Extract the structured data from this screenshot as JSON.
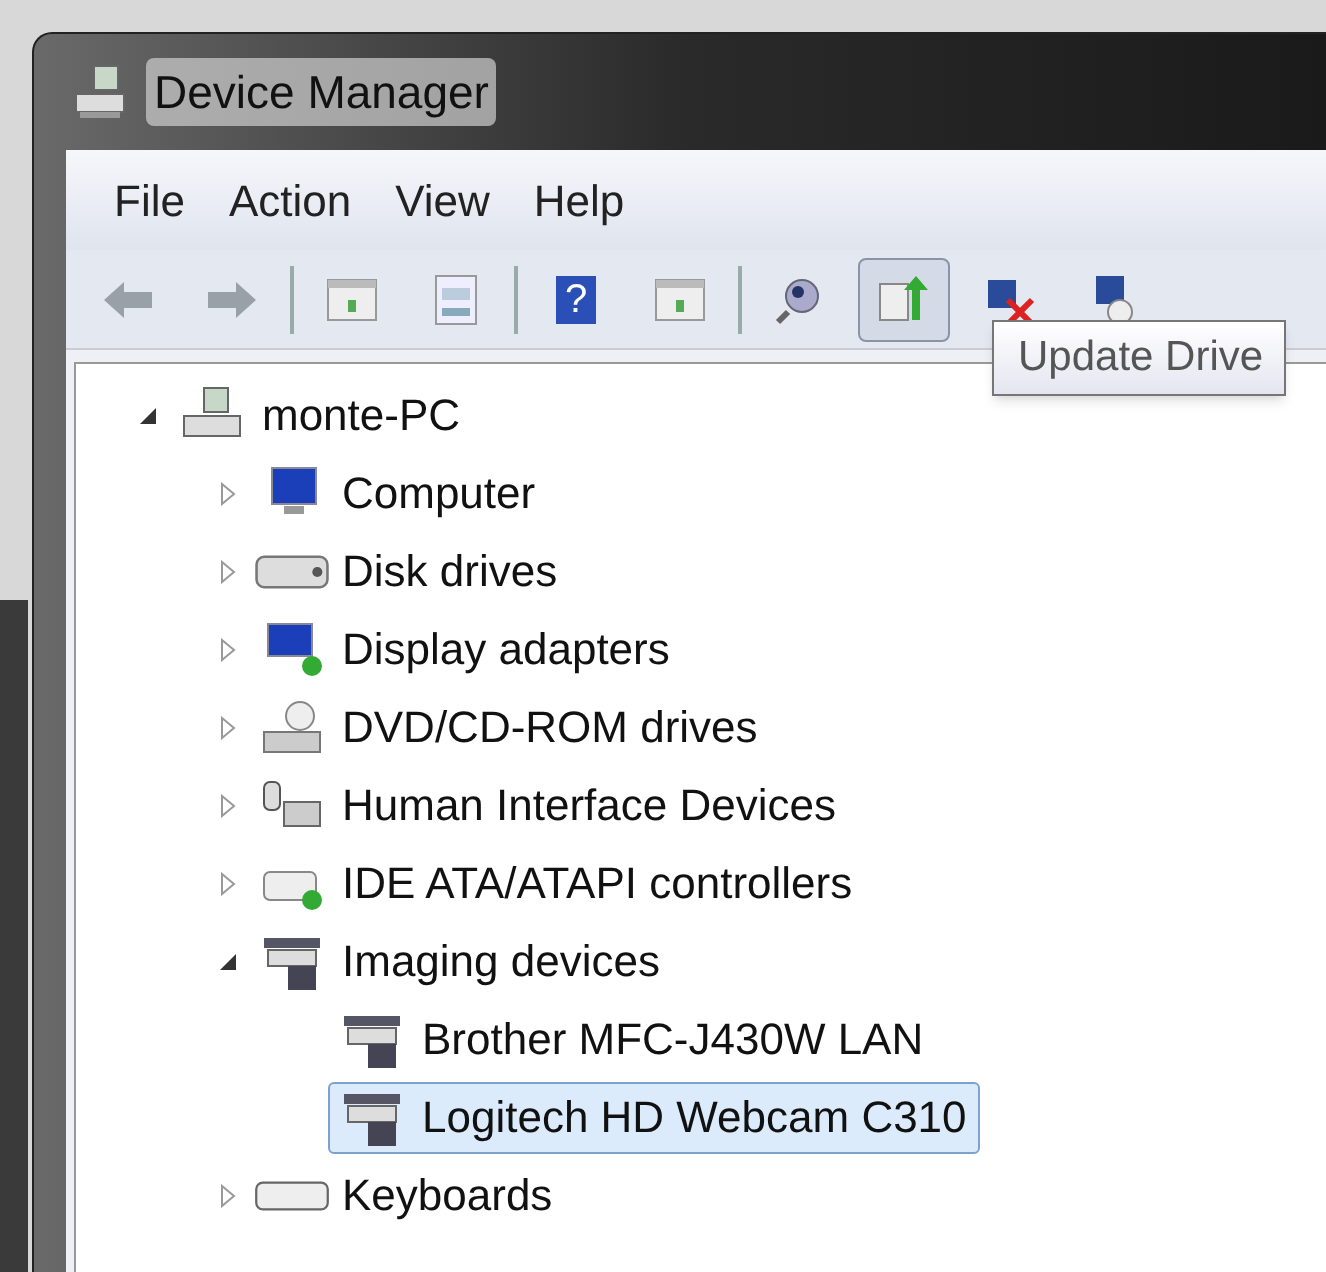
{
  "window": {
    "title": "Device Manager"
  },
  "menu": [
    "File",
    "Action",
    "View",
    "Help"
  ],
  "toolbar": [
    {
      "kind": "back",
      "pressed": false
    },
    {
      "kind": "forward",
      "pressed": false
    },
    {
      "kind": "separator"
    },
    {
      "kind": "properties",
      "pressed": false
    },
    {
      "kind": "document",
      "pressed": false
    },
    {
      "kind": "separator"
    },
    {
      "kind": "help",
      "label": "?",
      "pressed": false
    },
    {
      "kind": "properties",
      "pressed": false
    },
    {
      "kind": "separator"
    },
    {
      "kind": "scan",
      "pressed": false
    },
    {
      "kind": "update",
      "pressed": true
    },
    {
      "kind": "disable",
      "pressed": false
    },
    {
      "kind": "uninstall",
      "pressed": false
    }
  ],
  "tooltip": {
    "text": "Update Drive"
  },
  "tree": [
    {
      "label": "monte-PC",
      "kind": "computer",
      "expanded": true,
      "selected": false,
      "children": [
        {
          "label": "Computer",
          "kind": "monitor",
          "expanded": false,
          "selected": false
        },
        {
          "label": "Disk drives",
          "kind": "disk",
          "expanded": false,
          "selected": false
        },
        {
          "label": "Display adapters",
          "kind": "display",
          "expanded": false,
          "selected": false
        },
        {
          "label": "DVD/CD-ROM drives",
          "kind": "dvd",
          "expanded": false,
          "selected": false
        },
        {
          "label": "Human Interface Devices",
          "kind": "hid",
          "expanded": false,
          "selected": false
        },
        {
          "label": "IDE ATA/ATAPI controllers",
          "kind": "ide",
          "expanded": false,
          "selected": false
        },
        {
          "label": "Imaging devices",
          "kind": "imaging",
          "expanded": true,
          "selected": false,
          "children": [
            {
              "label": "Brother MFC-J430W LAN",
              "kind": "imaging",
              "selected": false
            },
            {
              "label": "Logitech HD Webcam C310",
              "kind": "imaging",
              "selected": true
            }
          ]
        },
        {
          "label": "Keyboards",
          "kind": "keyboard",
          "expanded": false,
          "selected": false
        }
      ]
    }
  ]
}
